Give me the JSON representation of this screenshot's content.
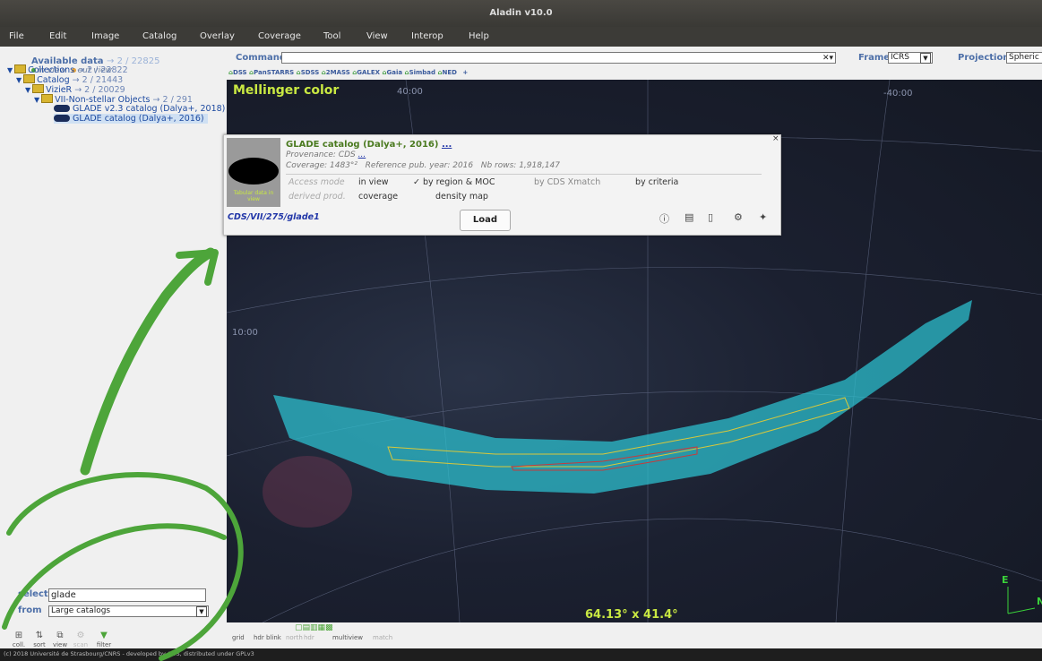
{
  "window": {
    "title": "Aladin v10.0"
  },
  "menu": [
    "File",
    "Edit",
    "Image",
    "Catalog",
    "Overlay",
    "Coverage",
    "Tool",
    "View",
    "Interop",
    "Help"
  ],
  "left_panel": {
    "available_label": "Available data",
    "available_count": "→ 2 / 22825",
    "legend_in": "in view",
    "legend_out": "out view",
    "tree": [
      {
        "label": "Collections",
        "count": "→ 2 / 22822"
      },
      {
        "label": "Catalog",
        "count": "→ 2 / 21443"
      },
      {
        "label": "VizieR",
        "count": "→ 2 / 20029"
      },
      {
        "label": "VII-Non-stellar Objects",
        "count": "→ 2 / 291"
      },
      {
        "label": "GLADE v2.3 catalog (Dalya+, 2018)"
      },
      {
        "label": "GLADE catalog (Dalya+, 2016)"
      }
    ],
    "select_label": "select",
    "select_value": "glade",
    "from_label": "from",
    "from_value": "Large catalogs",
    "tools": [
      "coll.",
      "sort",
      "view",
      "scan",
      "filter"
    ]
  },
  "top": {
    "command_label": "Command",
    "frame_label": "Frame",
    "frame_value": "ICRS",
    "projection_label": "Projection",
    "projection_value": "Spheric",
    "shortcuts": [
      "DSS",
      "PanSTARRS",
      "SDSS",
      "2MASS",
      "GALEX",
      "Gaia",
      "Simbad",
      "NED"
    ],
    "shortcut_add": "+"
  },
  "view": {
    "survey_label": "Mellinger color",
    "fov": "64.13° x 41.4°",
    "grid_labels": [
      "40:00",
      "-40:00",
      "10:00"
    ],
    "compass_e": "E",
    "compass_n": "N"
  },
  "popup": {
    "title": "GLADE catalog (Dalya+, 2016)",
    "title_more": "...",
    "provenance": "Provenance: CDS",
    "provenance_more": "...",
    "coverage": "Coverage: 1483°²",
    "ref_year": "Reference pub. year: 2016",
    "nb_rows": "Nb rows: 1,918,147",
    "thumb_text": "Tabular data in view",
    "access_label": "Access mode",
    "access_options": [
      "in view",
      "✓ by region & MOC",
      "by CDS Xmatch",
      "by criteria"
    ],
    "derived_label": "derived prod.",
    "derived_options": [
      "coverage",
      "density map"
    ],
    "id": "CDS/VII/275/glade1",
    "load_label": "Load",
    "close": "×"
  },
  "bottom": {
    "tools": [
      "grid",
      "hdr",
      "blink",
      "north",
      "hdr",
      "multiview",
      "match"
    ]
  },
  "status": "(c) 2018 Université de Strasbourg/CNRS - developed by CDS, distributed under GPLv3",
  "colors": {
    "accent": "#4d6fa8",
    "survey_label": "#c9e842",
    "coverage": "#2dc4d2",
    "annotation": "#4da53a"
  }
}
